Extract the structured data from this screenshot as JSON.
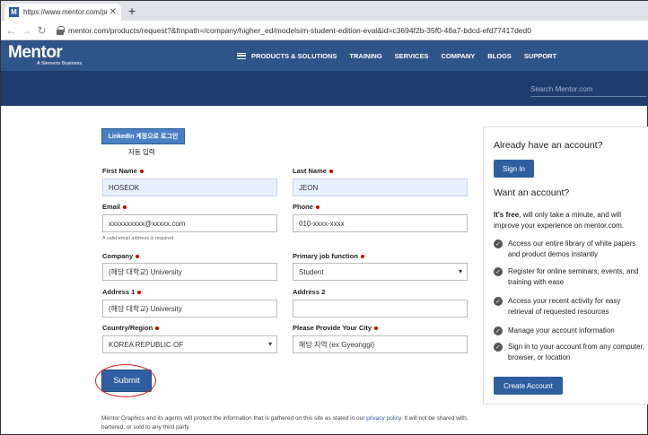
{
  "browser": {
    "tab_title": "https://www.mentor.com/prod",
    "tab_favicon": "M",
    "new_tab": "+",
    "url": "mentor.com/products/request?&fmpath=/company/higher_ed/modelsim-student-edition-eval&id=c3694f2b-35f0-48a7-bdcd-efd77417ded0"
  },
  "site": {
    "logo": "Mentor",
    "logo_sub": "A Siemens Business",
    "menu": [
      "PRODUCTS & SOLUTIONS",
      "TRAINING",
      "SERVICES",
      "COMPANY",
      "BLOGS",
      "SUPPORT"
    ],
    "search_placeholder": "Search Mentor.com"
  },
  "form": {
    "linkedin_label": "LinkedIn 계정으로 로그인",
    "autofill_label": "자동 입력",
    "first_name": {
      "label": "First Name",
      "value": "HOSEOK"
    },
    "last_name": {
      "label": "Last Name",
      "value": "JEON"
    },
    "email": {
      "label": "Email",
      "value": "xxxxxxxxxx@xxxxx.com",
      "hint": "A valid email address is required."
    },
    "phone": {
      "label": "Phone",
      "value": "010-xxxx-xxxx"
    },
    "company": {
      "label": "Company",
      "value": "(해당 대학교) University"
    },
    "job": {
      "label": "Primary job function",
      "value": "Student"
    },
    "address1": {
      "label": "Address 1",
      "value": "(해당 대학교) University"
    },
    "address2": {
      "label": "Address 2",
      "value": ""
    },
    "country": {
      "label": "Country/Region",
      "value": "KOREA REPUBLIC OF"
    },
    "city": {
      "label": "Please Provide Your City",
      "value": "해당 지역 (ex Gyeonggi)"
    },
    "submit_label": "Submit",
    "privacy_pre": "Mentor Graphics and its agents will protect the information that is gathered on this site as stated in our ",
    "privacy_link": "privacy policy",
    "privacy_post": ". It will not be shared with, bartered, or sold to any third party."
  },
  "sidebar": {
    "have_account": "Already have an account?",
    "sign_in": "Sign In",
    "want_account": "Want an account?",
    "free_bold": "It's free",
    "free_rest": ", will only take a minute, and will improve your experience on mentor.com.",
    "benefits": [
      "Access our entire library of white papers and product demos instantly",
      "Register for online seminars, events, and training with ease",
      "Access your recent activity for easy retrieval of requested resources",
      "Manage your account information",
      "Sign in to your account from any computer, browser, or location"
    ],
    "create_account": "Create Account"
  },
  "colors": {
    "nav": "#2f5488",
    "banner": "#1e3d6c",
    "button": "#2f5fa0",
    "required": "#cc0000",
    "highlight": "#e02020"
  }
}
